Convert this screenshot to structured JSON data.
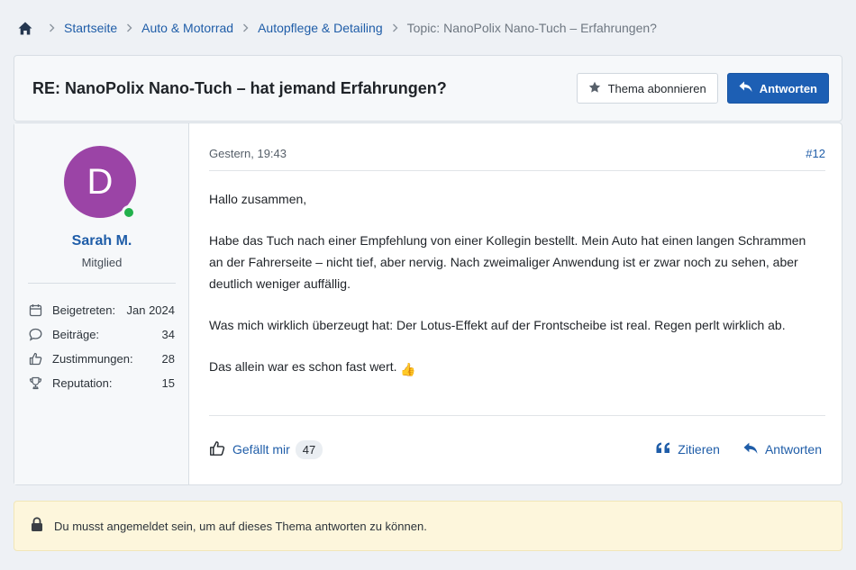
{
  "breadcrumb": {
    "items": [
      "Startseite",
      "Auto & Motorrad",
      "Autopflege & Detailing"
    ],
    "current": "Topic: NanoPolix Nano-Tuch – Erfahrungen?"
  },
  "thread": {
    "title": "RE: NanoPolix Nano-Tuch – hat jemand Erfahrungen?",
    "subscribe_label": "Thema abonnieren",
    "reply_label": "Antworten"
  },
  "user": {
    "initial": "D",
    "avatar_color": "#9b44a6",
    "online_color": "#22b14c",
    "name": "Sarah M.",
    "role": "Mitglied",
    "stats": [
      {
        "label": "Beigetreten:",
        "value": "Jan 2024",
        "icon": "calendar-icon"
      },
      {
        "label": "Beiträge:",
        "value": "34",
        "icon": "speech-bubble-icon"
      },
      {
        "label": "Zustimmungen:",
        "value": "28",
        "icon": "thumbs-up-icon"
      },
      {
        "label": "Reputation:",
        "value": "15",
        "icon": "trophy-icon"
      }
    ]
  },
  "post": {
    "date": "Gestern, 19:43",
    "number": "#12",
    "paragraphs": [
      "Hallo zusammen,",
      "Habe das Tuch nach einer Empfehlung von einer Kollegin bestellt. Mein Auto hat einen langen Schrammen an der Fahrerseite – nicht tief, aber nervig. Nach zweimaliger Anwendung ist er zwar noch zu sehen, aber deutlich weniger auffällig.",
      "Was mich wirklich überzeugt hat: Der Lotus-Effekt auf der Frontscheibe ist real. Regen perlt wirklich ab.",
      "Das allein war es schon fast wert."
    ],
    "emoji": "👍",
    "like_label": "Gefällt mir",
    "like_count": "47",
    "quote_label": "Zitieren",
    "reply_label": "Antworten"
  },
  "notice": {
    "text": "Du musst angemeldet sein, um auf dieses Thema antworten zu können.",
    "icon": "lock-icon"
  },
  "colors": {
    "link": "#1f5da8",
    "primary_button": "#1d5fb4",
    "notice_bg": "#fdf6dc"
  }
}
